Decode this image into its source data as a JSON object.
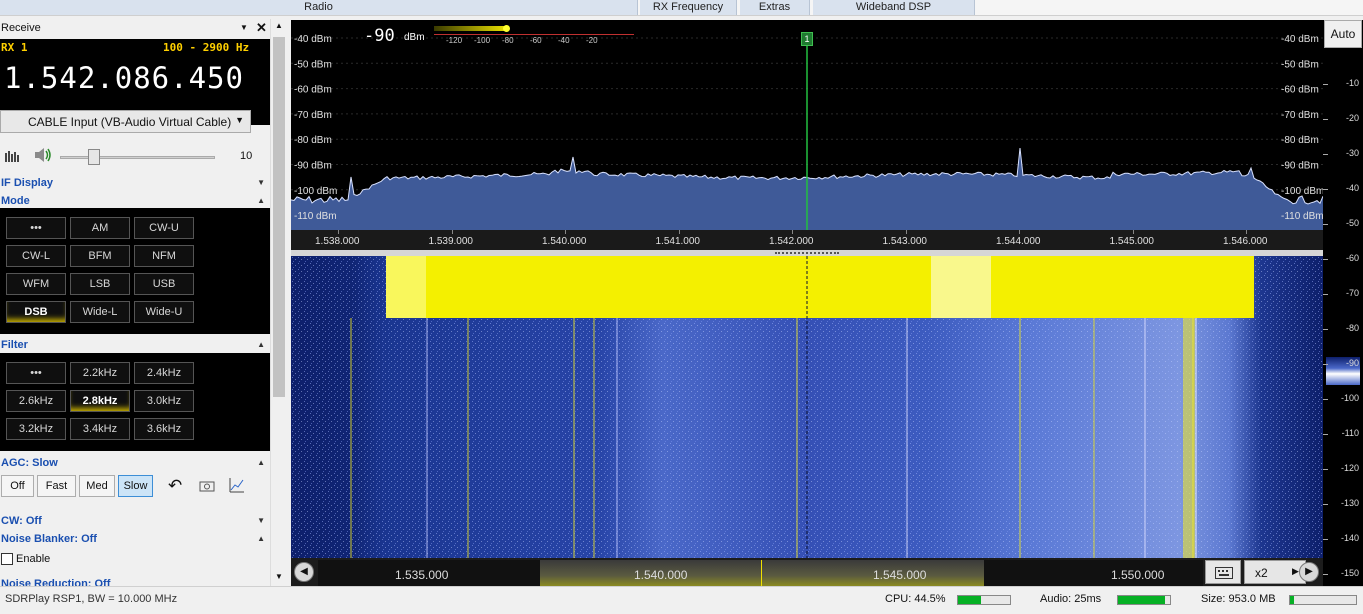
{
  "menu": {
    "radio": "Radio",
    "rx_frequency": "RX Frequency",
    "extras": "Extras",
    "wideband_dsp": "Wideband DSP"
  },
  "receive": {
    "title": "Receive",
    "rx_label": "RX 1",
    "band": "100 - 2900 Hz",
    "frequency": "1.542.086.450",
    "audio_device": "CABLE Input (VB-Audio Virtual Cable)",
    "volume_value": "10",
    "volume_fraction": 0.08
  },
  "sections": {
    "if_display": "IF Display",
    "mode": "Mode",
    "filter": "Filter",
    "agc": "AGC: Slow",
    "cw": "CW: Off",
    "noise_blanker": "Noise Blanker: Off",
    "noise_reduction": "Noise Reduction: Off",
    "enable": "Enable"
  },
  "mode_buttons": [
    "•••",
    "AM",
    "CW-U",
    "CW-L",
    "BFM",
    "NFM",
    "WFM",
    "LSB",
    "USB",
    "DSB",
    "Wide-L",
    "Wide-U"
  ],
  "mode_selected": 9,
  "filter_buttons": [
    "•••",
    "2.2kHz",
    "2.4kHz",
    "2.6kHz",
    "2.8kHz",
    "3.0kHz",
    "3.2kHz",
    "3.4kHz",
    "3.6kHz"
  ],
  "filter_selected": 4,
  "agc_buttons": [
    "Off",
    "Fast",
    "Med",
    "Slow"
  ],
  "agc_selected": 3,
  "spectrum": {
    "signal_value": "-90",
    "signal_unit": "dBm",
    "meter_ticks": [
      "-120",
      "-100",
      "-80",
      "-60",
      "-40",
      "-20"
    ],
    "db_labels": [
      "-40 dBm",
      "-50 dBm",
      "-60 dBm",
      "-70 dBm",
      "-80 dBm",
      "-90 dBm",
      "-100 dBm",
      "-110 dBm"
    ],
    "freq_labels": [
      "1.538.000",
      "1.539.000",
      "1.540.000",
      "1.541.000",
      "1.542.000",
      "1.543.000",
      "1.544.000",
      "1.545.000",
      "1.546.000"
    ],
    "marker_label": "1"
  },
  "overview": {
    "freq_labels": [
      "1.535.000",
      "1.540.000",
      "1.545.000",
      "1.550.000"
    ],
    "zoom": "x2"
  },
  "right_scale": {
    "auto": "Auto",
    "ticks": [
      "-10",
      "-20",
      "-30",
      "-40",
      "-50",
      "-60",
      "-70",
      "-80",
      "-90",
      "-100",
      "-110",
      "-120",
      "-130",
      "-140",
      "-150"
    ]
  },
  "status": {
    "device": "SDRPlay RSP1, BW = 10.000 MHz",
    "cpu": "CPU: 44.5%",
    "cpu_level": 0.445,
    "audio": "Audio: 25ms",
    "audio_level": 0.9,
    "size": "Size: 953.0 MB",
    "size_level": 0.06
  },
  "colors": {
    "accent_blue": "#1a4fb0",
    "spectrum_fill": "#3f5a98",
    "waterfall_yellow": "#f4f000",
    "marker_green": "#22c040"
  }
}
